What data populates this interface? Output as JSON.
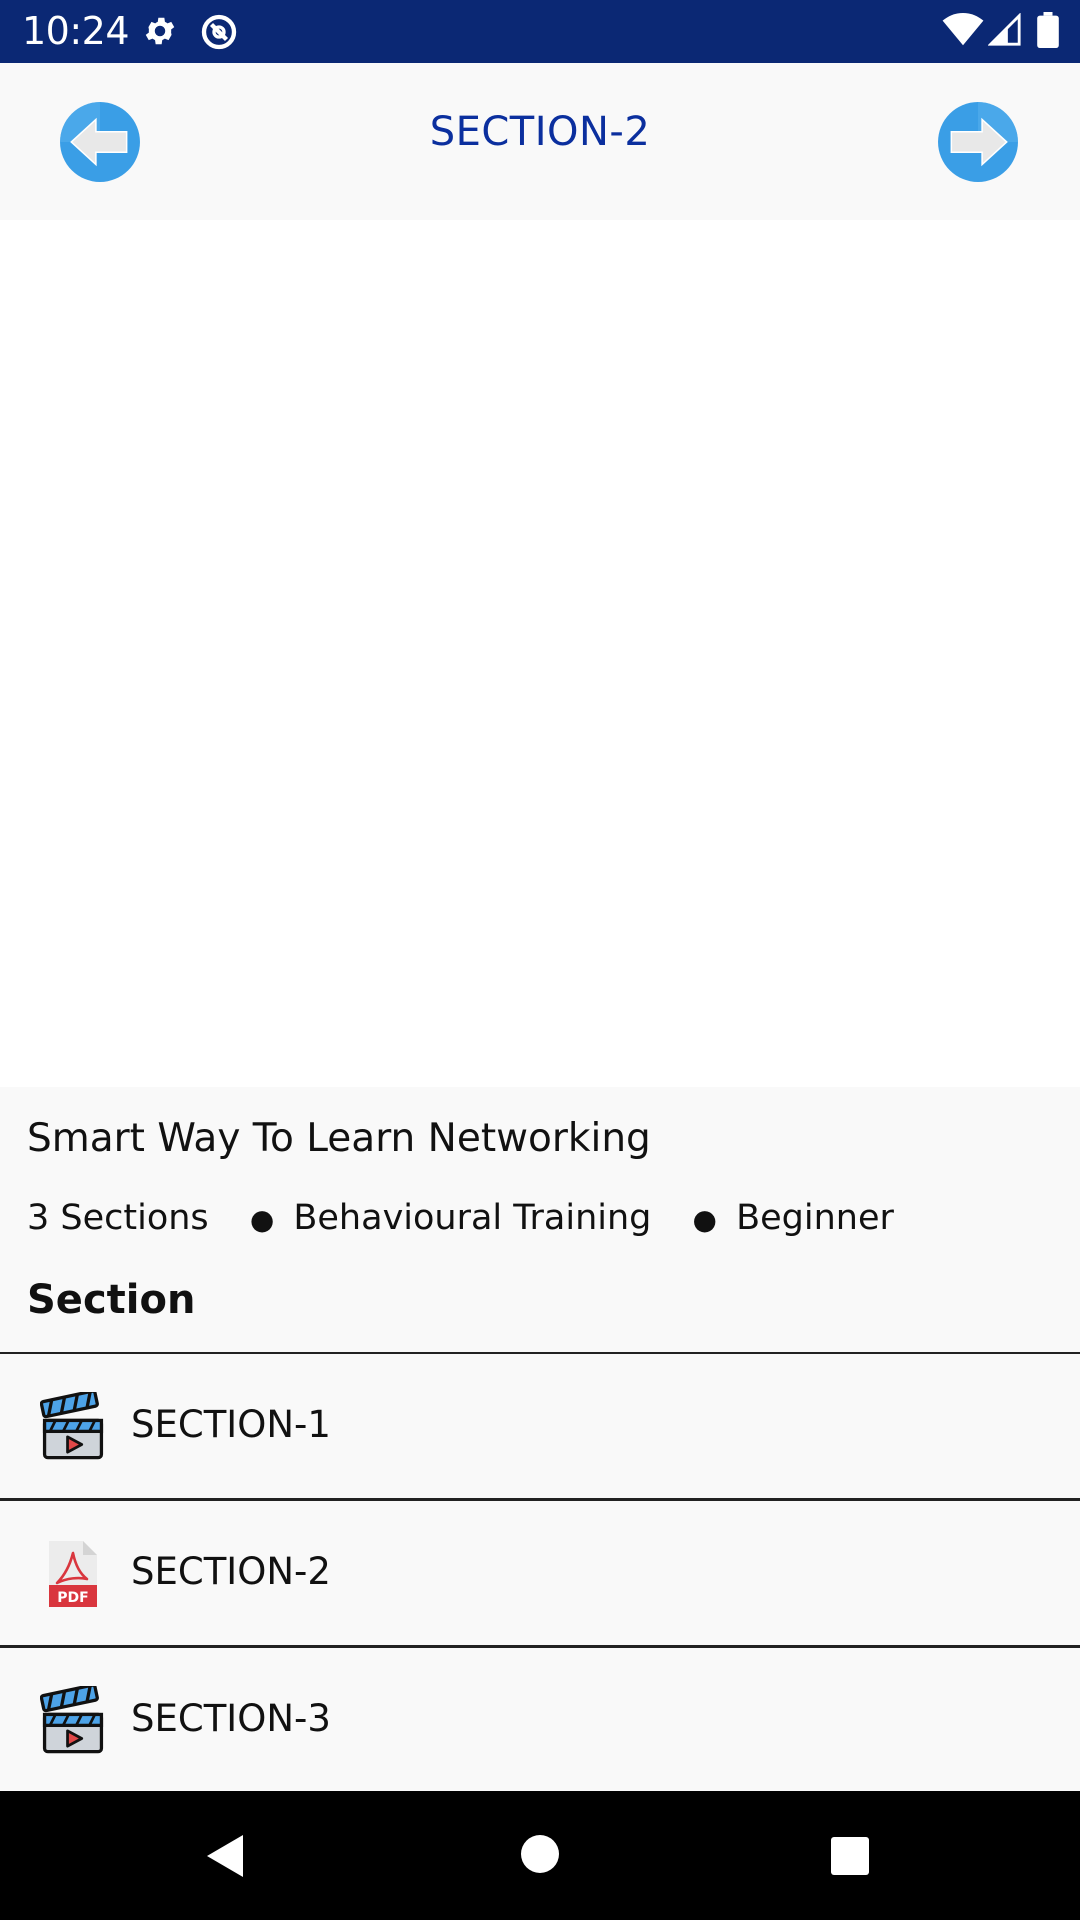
{
  "status_bar": {
    "time": "10:24",
    "icons": [
      "gear-icon",
      "sync-icon",
      "wifi-icon",
      "signal-icon",
      "battery-icon"
    ],
    "background": "#0b2874"
  },
  "app_bar": {
    "title": "SECTION-2",
    "prev_icon": "arrow-left-icon",
    "next_icon": "arrow-right-icon",
    "title_color": "#0b2f9e",
    "button_color": "#3a9ee6"
  },
  "course": {
    "title": "Smart Way To Learn Networking",
    "sections_count": "3 Sections",
    "category": "Behavioural Training",
    "level": "Beginner",
    "section_heading": "Section"
  },
  "sections": [
    {
      "label": "SECTION-1",
      "icon": "video-clapper-icon"
    },
    {
      "label": "SECTION-2",
      "icon": "pdf-file-icon"
    },
    {
      "label": "SECTION-3",
      "icon": "video-clapper-icon"
    }
  ],
  "system_nav": {
    "icons": [
      "back-icon",
      "home-icon",
      "recents-icon"
    ]
  }
}
